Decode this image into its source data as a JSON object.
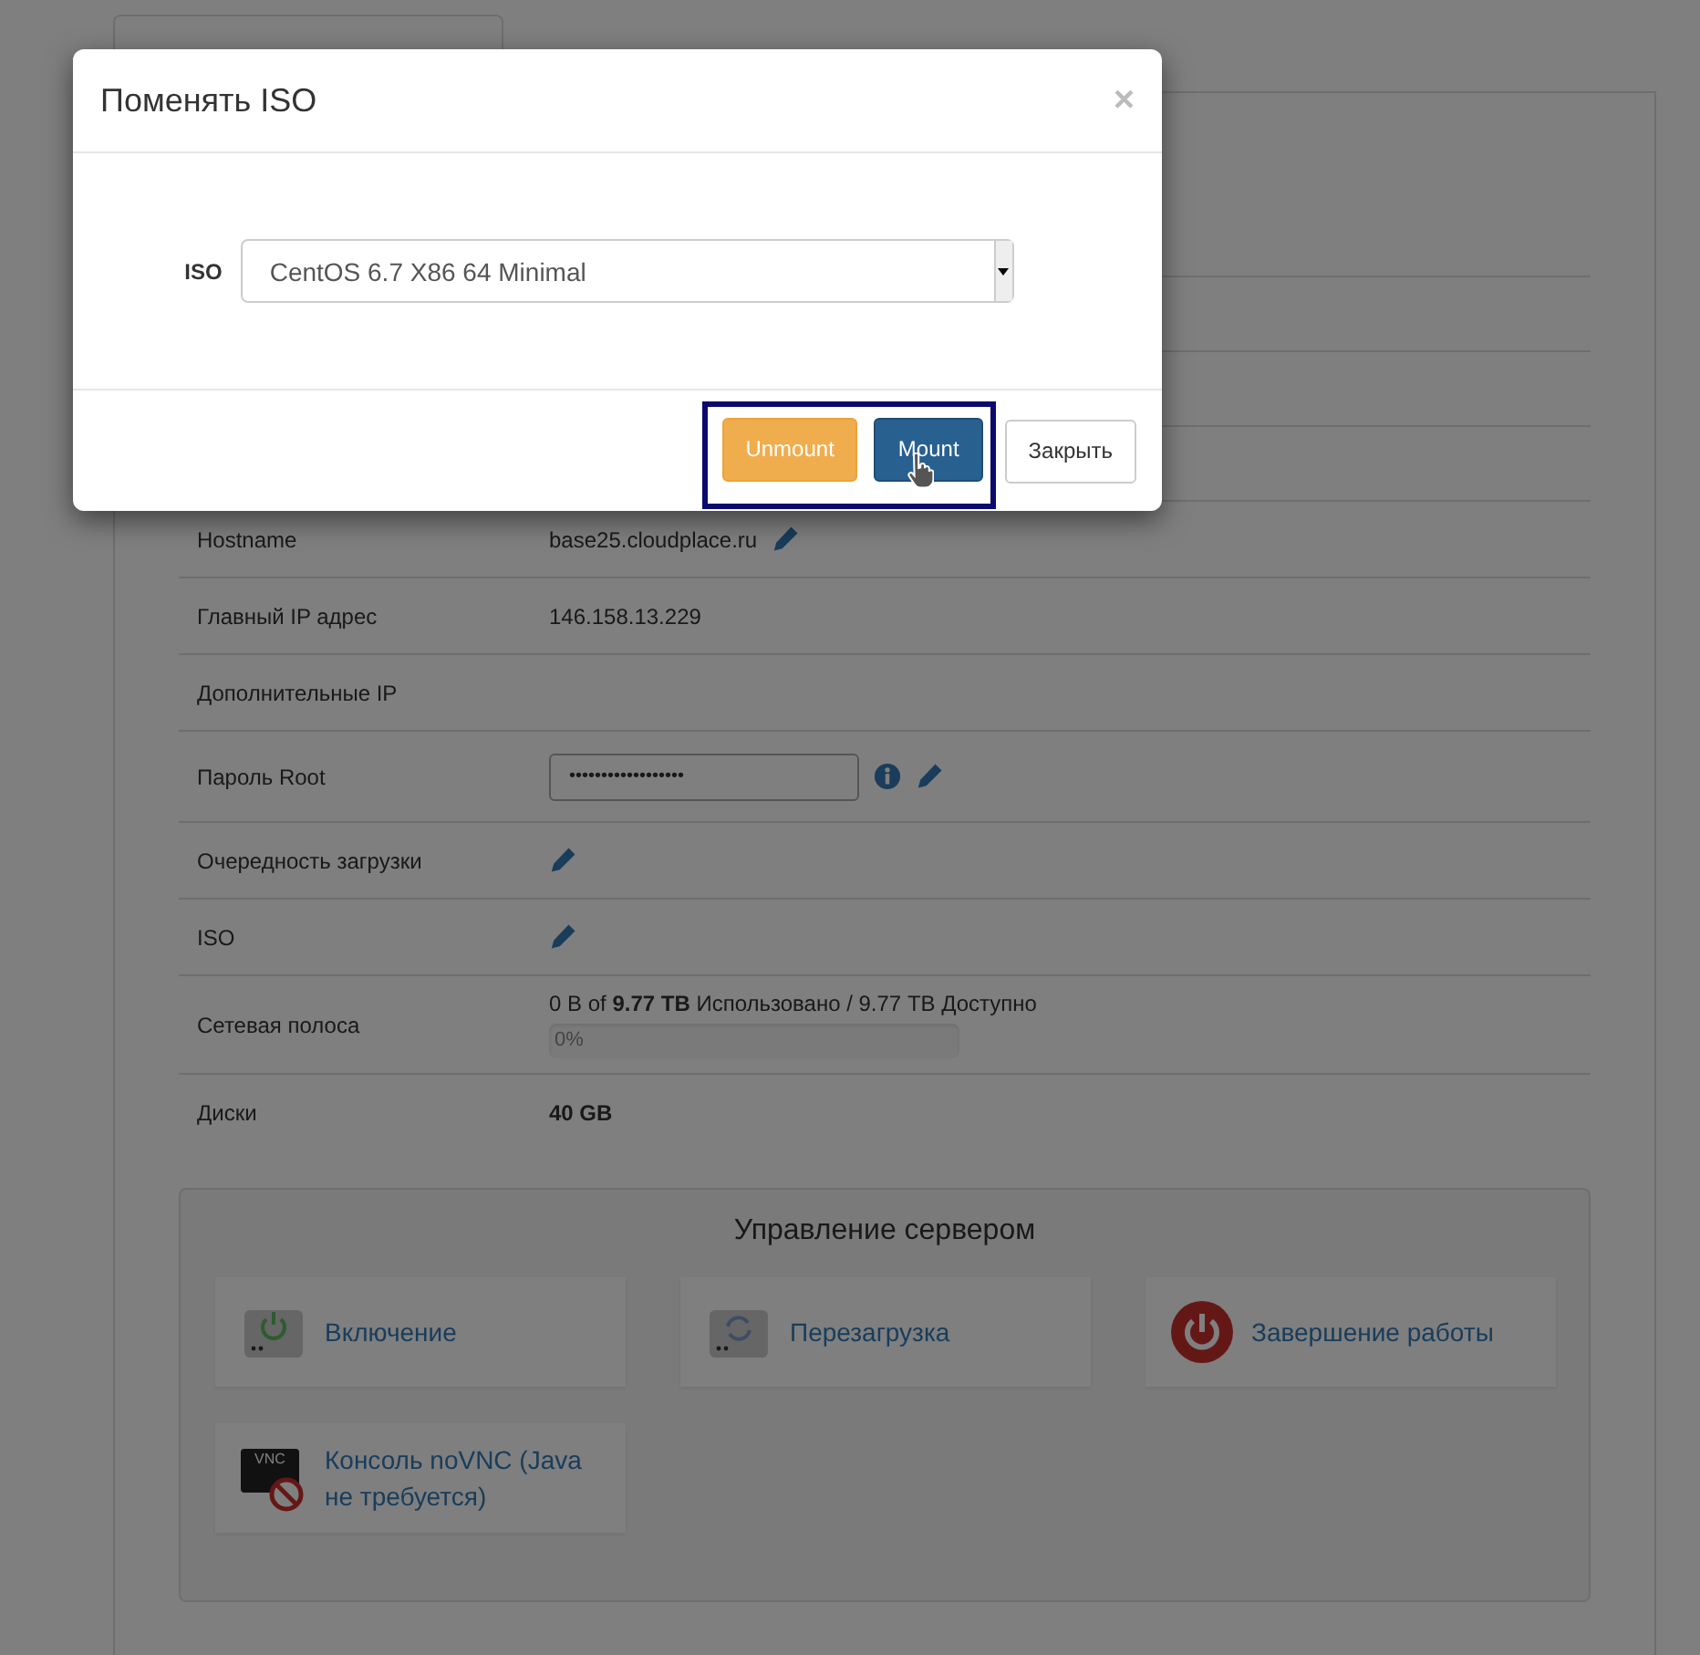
{
  "details": [
    {
      "label": "Hostname",
      "kind": "text",
      "value": "base25.cloudplace.ru",
      "editable": true
    },
    {
      "label": "Главный IP адрес",
      "kind": "text",
      "value": "146.158.13.229",
      "editable": false
    },
    {
      "label": "Дополнительные IP",
      "kind": "text",
      "editable": false
    },
    {
      "label": "Пароль Root",
      "kind": "password",
      "value": "••••••••••••••••••",
      "info": true,
      "editable": true
    },
    {
      "label": "Очередность загрузки",
      "kind": "text",
      "editable": true
    },
    {
      "label": "ISO",
      "kind": "text",
      "editable": true
    },
    {
      "label": "Сетевая полоса",
      "kind": "bandwidth",
      "value": "0 B of **9.77 TB** Использовано / 9.77 TB Доступно",
      "level": 0,
      "bar_label": "0%"
    },
    {
      "label": "Диски",
      "kind": "bold",
      "value": "40 GB"
    }
  ],
  "server_control": {
    "title": "Управление сервером",
    "actions": [
      {
        "kind": "power_on",
        "label": "Включение"
      },
      {
        "kind": "reboot",
        "label": "Перезагрузка"
      },
      {
        "kind": "shutdown",
        "label": "Завершение работы"
      },
      {
        "kind": "console",
        "label": "Консоль noVNC (Java не требуется)",
        "icon_text": "VNC"
      }
    ]
  },
  "modal": {
    "title": "Поменять ISO",
    "close": "×",
    "field_label": "ISO",
    "select_value": "CentOS 6.7 X86 64 Minimal",
    "buttons": [
      {
        "kind": "warning",
        "label": "Unmount",
        "highlighted": true
      },
      {
        "kind": "primary",
        "label": "Mount",
        "highlighted": true,
        "hovered": true
      },
      {
        "kind": "default",
        "label": "Закрыть",
        "highlighted": false
      }
    ]
  }
}
